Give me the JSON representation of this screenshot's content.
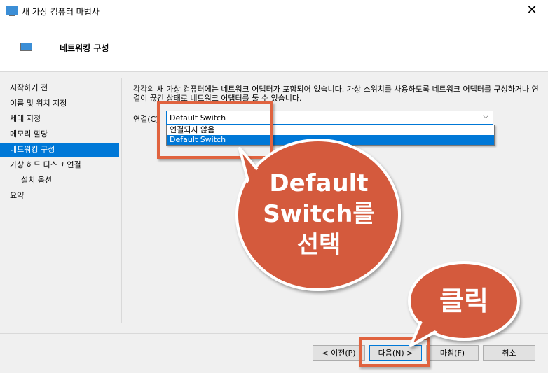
{
  "window": {
    "title": "새 가상 컴퓨터 마법사",
    "close_glyph": "✕"
  },
  "header": {
    "title": "네트워킹 구성"
  },
  "sidebar": {
    "items": [
      {
        "label": "시작하기 전"
      },
      {
        "label": "이름 및 위치 지정"
      },
      {
        "label": "세대 지정"
      },
      {
        "label": "메모리 할당"
      },
      {
        "label": "네트워킹 구성"
      },
      {
        "label": "가상 하드 디스크 연결"
      },
      {
        "label": "설치 옵션"
      },
      {
        "label": "요약"
      }
    ],
    "active_index": 4
  },
  "main": {
    "description": "각각의 새 가상 컴퓨터에는 네트워크 어댑터가 포함되어 있습니다. 가상 스위치를 사용하도록 네트워크 어댑터를 구성하거나 연결이 끊긴 상태로 네트워크 어댑터를 둘 수 있습니다.",
    "connection_label": "연결(C):",
    "connection_value": "Default Switch",
    "dropdown_arrow": "⌵",
    "options": [
      "연결되지 않음",
      "Default Switch"
    ],
    "selected_option_index": 1
  },
  "buttons": {
    "prev": "< 이전(P)",
    "next": "다음(N) >",
    "finish": "마침(F)",
    "cancel": "취소"
  },
  "annotations": {
    "bubble1_text": "Default Switch를 선택",
    "bubble1_lines": [
      "Default",
      "Switch를",
      "선택"
    ],
    "bubble2_text": "클릭",
    "accent_color": "#e0633f",
    "bubble_fill": "#d45a3c"
  }
}
